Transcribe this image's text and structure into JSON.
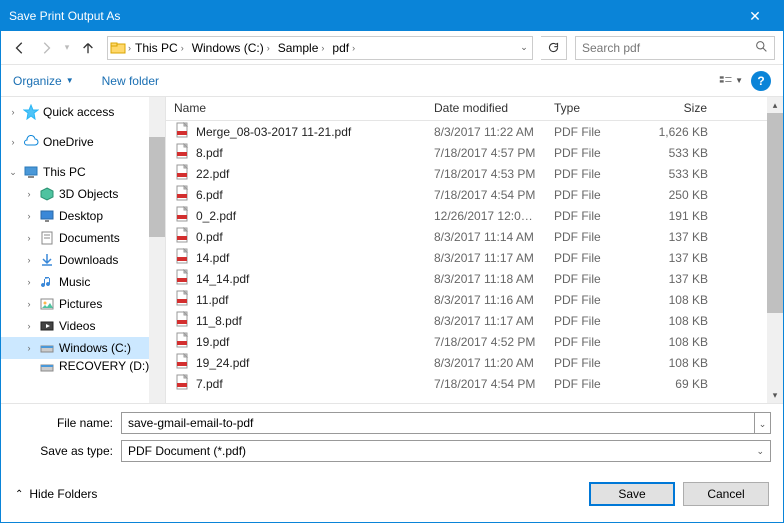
{
  "window": {
    "title": "Save Print Output As"
  },
  "breadcrumbs": [
    "This PC",
    "Windows (C:)",
    "Sample",
    "pdf"
  ],
  "search": {
    "placeholder": "Search pdf"
  },
  "toolbar": {
    "organize": "Organize",
    "newfolder": "New folder"
  },
  "tree": [
    {
      "label": "Quick access",
      "icon": "star",
      "level": 1,
      "exp": ">"
    },
    {
      "label": "",
      "spacer": true
    },
    {
      "label": "OneDrive",
      "icon": "cloud",
      "level": 1,
      "exp": ">"
    },
    {
      "label": "",
      "spacer": true
    },
    {
      "label": "This PC",
      "icon": "pc",
      "level": 1,
      "exp": "v"
    },
    {
      "label": "3D Objects",
      "icon": "3d",
      "level": 2,
      "exp": ">"
    },
    {
      "label": "Desktop",
      "icon": "desktop",
      "level": 2,
      "exp": ">"
    },
    {
      "label": "Documents",
      "icon": "docs",
      "level": 2,
      "exp": ">"
    },
    {
      "label": "Downloads",
      "icon": "down",
      "level": 2,
      "exp": ">"
    },
    {
      "label": "Music",
      "icon": "music",
      "level": 2,
      "exp": ">"
    },
    {
      "label": "Pictures",
      "icon": "pics",
      "level": 2,
      "exp": ">"
    },
    {
      "label": "Videos",
      "icon": "vids",
      "level": 2,
      "exp": ">"
    },
    {
      "label": "Windows (C:)",
      "icon": "drive",
      "level": 2,
      "exp": ">",
      "selected": true
    },
    {
      "label": "RECOVERY (D:)",
      "icon": "drive",
      "level": 2,
      "exp": "",
      "cut": true
    }
  ],
  "columns": {
    "name": "Name",
    "date": "Date modified",
    "type": "Type",
    "size": "Size"
  },
  "files": [
    {
      "name": "Merge_08-03-2017 11-21.pdf",
      "date": "8/3/2017 11:22 AM",
      "type": "PDF File",
      "size": "1,626 KB"
    },
    {
      "name": "8.pdf",
      "date": "7/18/2017 4:57 PM",
      "type": "PDF File",
      "size": "533 KB"
    },
    {
      "name": "22.pdf",
      "date": "7/18/2017 4:53 PM",
      "type": "PDF File",
      "size": "533 KB"
    },
    {
      "name": "6.pdf",
      "date": "7/18/2017 4:54 PM",
      "type": "PDF File",
      "size": "250 KB"
    },
    {
      "name": "0_2.pdf",
      "date": "12/26/2017 12:00 ...",
      "type": "PDF File",
      "size": "191 KB"
    },
    {
      "name": "0.pdf",
      "date": "8/3/2017 11:14 AM",
      "type": "PDF File",
      "size": "137 KB"
    },
    {
      "name": "14.pdf",
      "date": "8/3/2017 11:17 AM",
      "type": "PDF File",
      "size": "137 KB"
    },
    {
      "name": "14_14.pdf",
      "date": "8/3/2017 11:18 AM",
      "type": "PDF File",
      "size": "137 KB"
    },
    {
      "name": "11.pdf",
      "date": "8/3/2017 11:16 AM",
      "type": "PDF File",
      "size": "108 KB"
    },
    {
      "name": "11_8.pdf",
      "date": "8/3/2017 11:17 AM",
      "type": "PDF File",
      "size": "108 KB"
    },
    {
      "name": "19.pdf",
      "date": "7/18/2017 4:52 PM",
      "type": "PDF File",
      "size": "108 KB"
    },
    {
      "name": "19_24.pdf",
      "date": "8/3/2017 11:20 AM",
      "type": "PDF File",
      "size": "108 KB"
    },
    {
      "name": "7.pdf",
      "date": "7/18/2017 4:54 PM",
      "type": "PDF File",
      "size": "69 KB"
    }
  ],
  "form": {
    "filename_label": "File name:",
    "filename_value": "save-gmail-email-to-pdf",
    "saveas_label": "Save as type:",
    "saveas_value": "PDF Document (*.pdf)"
  },
  "footer": {
    "hide_folders": "Hide Folders",
    "save": "Save",
    "cancel": "Cancel"
  }
}
